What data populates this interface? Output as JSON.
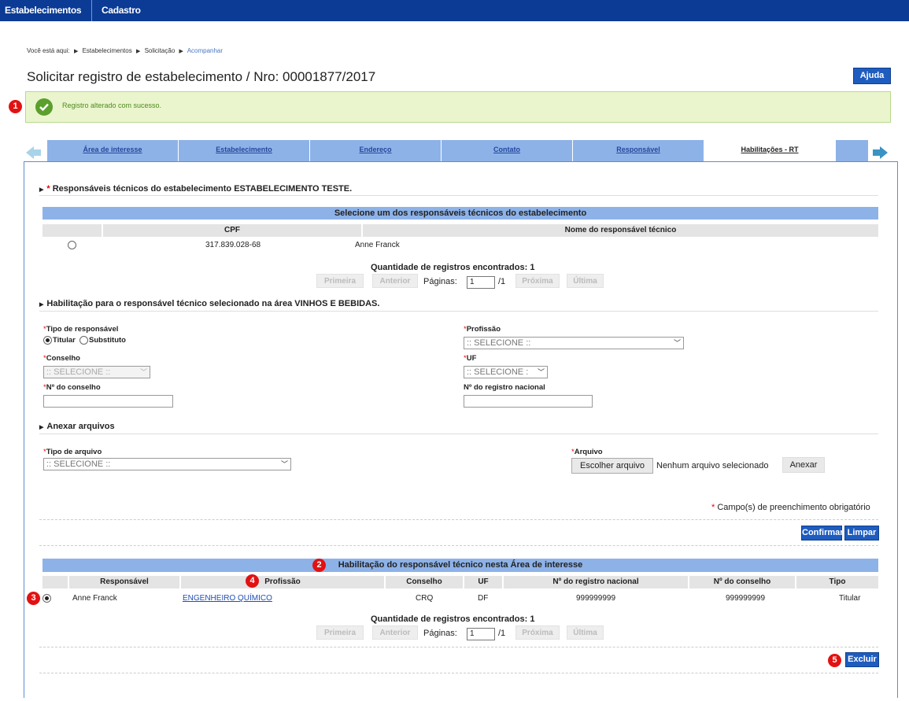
{
  "topbar": {
    "menu1": "Estabelecimentos",
    "menu2": "Cadastro"
  },
  "breadcrumb": {
    "prefix": "Você está aqui:",
    "item1": "Estabelecimentos",
    "item2": "Solicitação",
    "item3": "Acompanhar"
  },
  "page": {
    "title": "Solicitar registro de estabelecimento / Nro: 00001877/2017",
    "help_label": "Ajuda"
  },
  "success": {
    "message": "Registro alterado com sucesso."
  },
  "markers": {
    "m1": "1",
    "m2": "2",
    "m3": "3",
    "m4": "4",
    "m5": "5"
  },
  "tabs": [
    "Área de interesse",
    "Estabelecimento",
    "Endereço",
    "Contato",
    "Responsável",
    "Habilitações - RT"
  ],
  "section_rt": {
    "required_mark": "*",
    "title": "Responsáveis técnicos do estabelecimento ESTABELECIMENTO TESTE.",
    "table_title": "Selecione um dos responsáveis técnicos do estabelecimento",
    "col_cpf": "CPF",
    "col_name": "Nome do responsável técnico",
    "row": {
      "cpf": "317.839.028-68",
      "name": "Anne Franck"
    }
  },
  "pager": {
    "count_label": "Quantidade de registros encontrados:",
    "count": "1",
    "first": "Primeira",
    "prev": "Anterior",
    "pages_label": "Páginas:",
    "page": "1",
    "total": "/1",
    "next": "Próxima",
    "last": "Última"
  },
  "section_hab": {
    "title": "Habilitação para o responsável técnico selecionado na área VINHOS E BEBIDAS.",
    "tipo_label": "Tipo de responsável",
    "titular": "Titular",
    "substituto": "Substituto",
    "profissao_label": "Profissão",
    "profissao_value": ":: SELECIONE ::",
    "conselho_label": "Conselho",
    "conselho_value": ":: SELECIONE ::",
    "uf_label": "UF",
    "uf_value": ":: SELECIONE :",
    "nconselho_label": "Nº do conselho",
    "nregistro_label": "Nº do registro nacional"
  },
  "section_files": {
    "title": "Anexar arquivos",
    "tipo_label": "Tipo de arquivo",
    "tipo_value": ":: SELECIONE ::",
    "arquivo_label": "Arquivo",
    "choose_label": "Escolher arquivo",
    "no_file": "Nenhum arquivo selecionado",
    "attach_label": "Anexar"
  },
  "required_note": "Campo(s) de preenchimento obrigatório",
  "actions": {
    "confirm": "Confirmar",
    "clear": "Limpar",
    "delete": "Excluir"
  },
  "hab_table": {
    "title": "Habilitação do responsável técnico nesta Área de interesse",
    "headers": [
      "Responsável",
      "Profissão",
      "Conselho",
      "UF",
      "Nº do registro nacional",
      "Nº do conselho",
      "Tipo"
    ],
    "row": [
      "Anne Franck",
      "ENGENHEIRO QUÍMICO",
      "CRQ",
      "DF",
      "999999999",
      "999999999",
      "Titular"
    ]
  }
}
